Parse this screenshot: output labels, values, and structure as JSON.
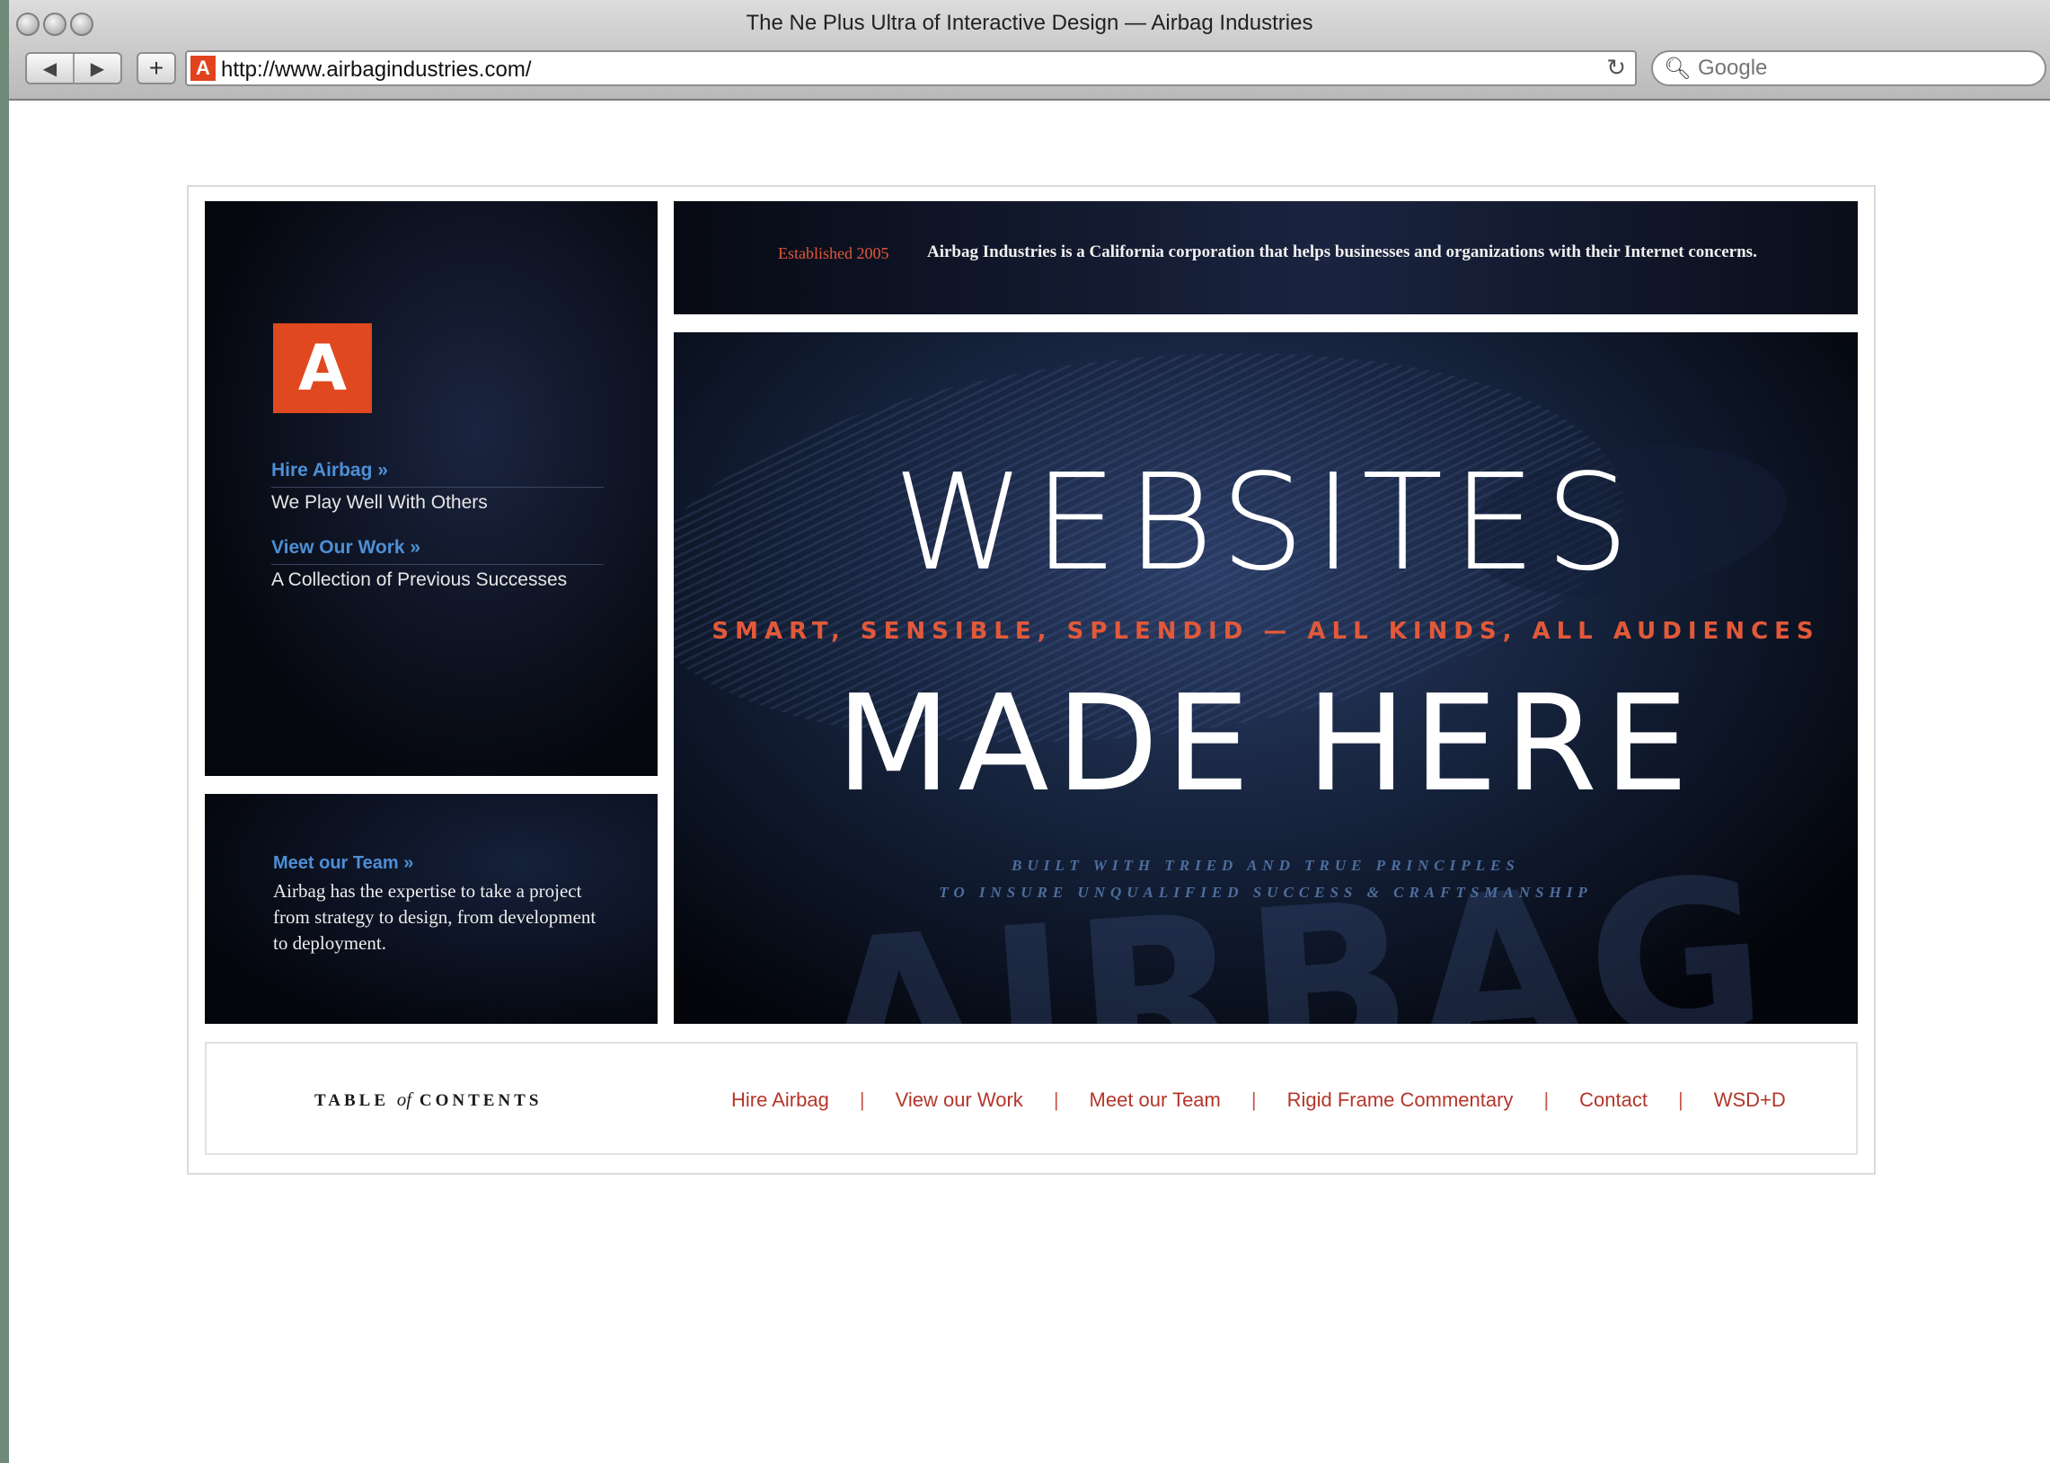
{
  "window": {
    "title": "The Ne Plus Ultra of Interactive Design — Airbag Industries",
    "url": "http://www.airbagindustries.com/",
    "search_placeholder": "Google"
  },
  "site": {
    "logo_letter": "A",
    "established": "Established 2005",
    "tagline": "Airbag Industries is a California corporation that helps businesses and organizations with their Internet concerns.",
    "sidebar": [
      {
        "link": "Hire Airbag »",
        "desc": "We Play Well With Others"
      },
      {
        "link": "View Our Work »",
        "desc": "A Collection of Previous Successes"
      }
    ],
    "team": {
      "link": "Meet our Team »",
      "text": "Airbag has the expertise to take a project from strategy to design, from development to deployment."
    },
    "hero": {
      "line1": "WEBSITES",
      "subline": "SMART, SENSIBLE, SPLENDID — ALL KINDS, ALL AUDIENCES",
      "line2": "MADE HERE",
      "built1": "BUILT WITH TRIED AND TRUE PRINCIPLES",
      "built2": "TO INSURE UNQUALIFIED SUCCESS & CRAFTSMANSHIP",
      "bg_word": "AIRBAG"
    },
    "toc": {
      "title_a": "TABLE",
      "title_of": "of",
      "title_b": "CONTENTS",
      "links": [
        "Hire Airbag",
        "View our Work",
        "Meet our Team",
        "Rigid Frame Commentary",
        "Contact",
        "WSD+D"
      ]
    }
  },
  "colors": {
    "accent": "#e0481f",
    "link_blue": "#4d8fd6",
    "toc_link": "#b4362a",
    "panel_dark": "#05070e"
  }
}
